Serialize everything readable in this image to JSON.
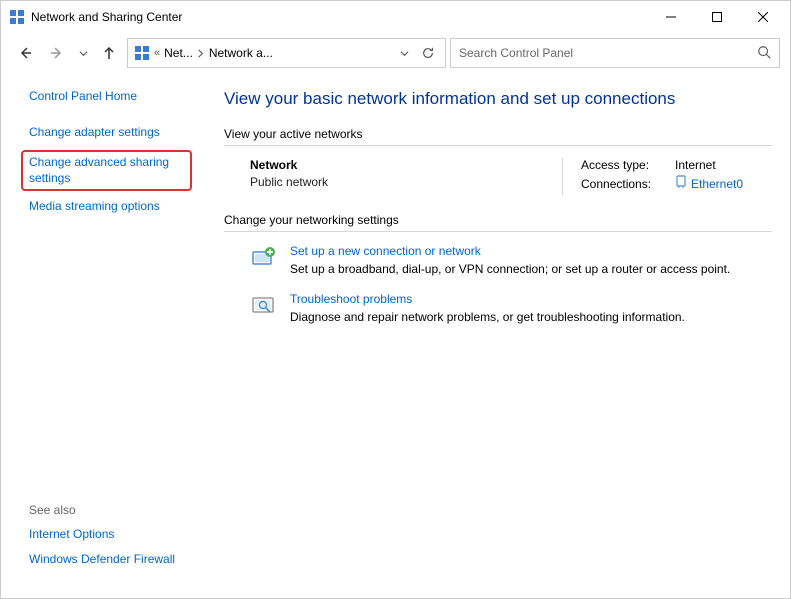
{
  "window": {
    "title": "Network and Sharing Center"
  },
  "breadcrumb": {
    "seg1": "Net...",
    "seg2": "Network a..."
  },
  "search": {
    "placeholder": "Search Control Panel"
  },
  "sidebar": {
    "home": "Control Panel Home",
    "items": [
      "Change adapter settings",
      "Change advanced sharing settings",
      "Media streaming options"
    ],
    "see_also_label": "See also",
    "see_also": [
      "Internet Options",
      "Windows Defender Firewall"
    ]
  },
  "content": {
    "title": "View your basic network information and set up connections",
    "active_heading": "View your active networks",
    "network": {
      "name": "Network",
      "type": "Public network",
      "access_key": "Access type:",
      "access_val": "Internet",
      "conn_key": "Connections:",
      "conn_val": "Ethernet0"
    },
    "change_heading": "Change your networking settings",
    "actions": [
      {
        "link": "Set up a new connection or network",
        "desc": "Set up a broadband, dial-up, or VPN connection; or set up a router or access point."
      },
      {
        "link": "Troubleshoot problems",
        "desc": "Diagnose and repair network problems, or get troubleshooting information."
      }
    ]
  }
}
